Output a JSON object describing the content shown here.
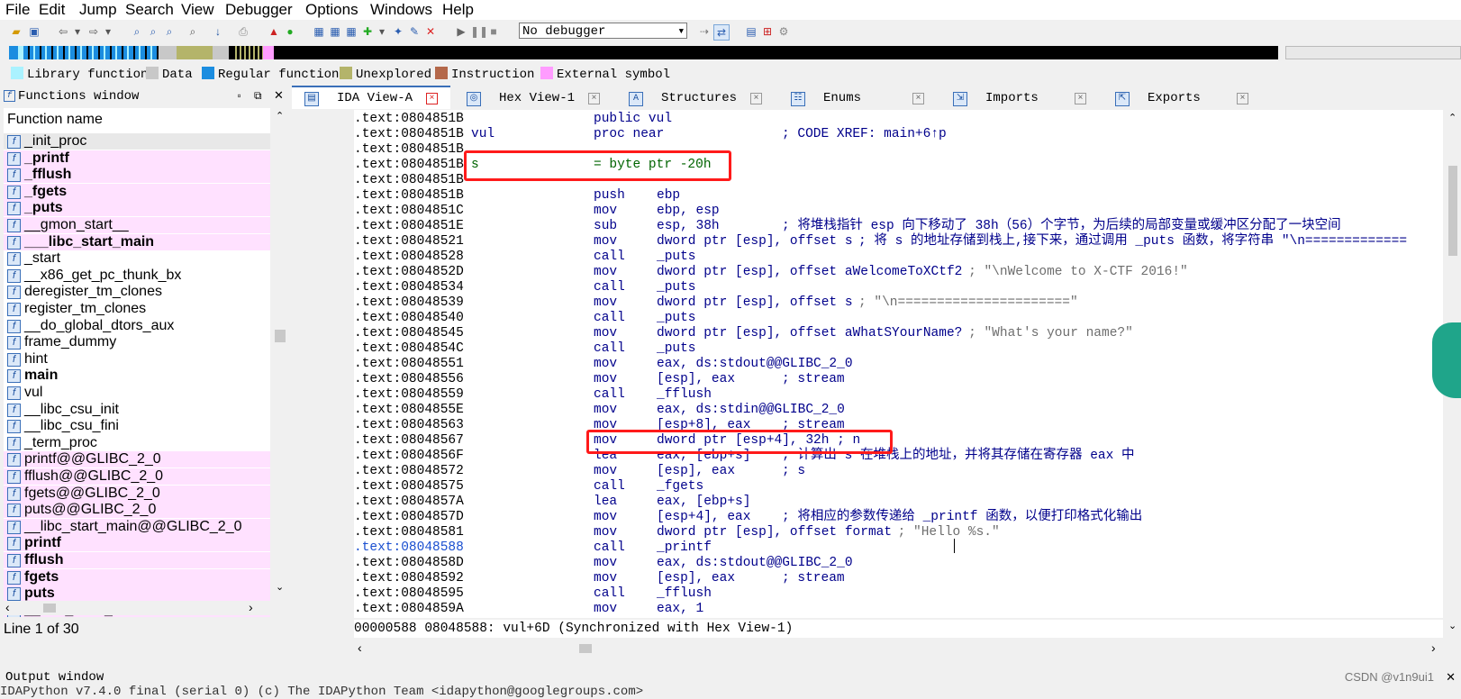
{
  "menu": [
    "File",
    "Edit",
    "Jump",
    "Search",
    "View",
    "Debugger",
    "Options",
    "Windows",
    "Help"
  ],
  "toolbar": {
    "debugger_select": "No debugger"
  },
  "legend": [
    {
      "label": "Library function",
      "color": "#aaf2ff"
    },
    {
      "label": "Data",
      "color": "#c8c8c8"
    },
    {
      "label": "Regular function",
      "color": "#1b8de0"
    },
    {
      "label": "Unexplored",
      "color": "#b4b46a"
    },
    {
      "label": "Instruction",
      "color": "#b4684a"
    },
    {
      "label": "External symbol",
      "color": "#ff9cff"
    }
  ],
  "functions_window": {
    "title": "Functions window",
    "header": "Function name",
    "status": "Line 1 of 30",
    "items": [
      {
        "name": "_init_proc",
        "bold": false,
        "pink": false,
        "sel": true
      },
      {
        "name": "_printf",
        "bold": true,
        "pink": true
      },
      {
        "name": "_fflush",
        "bold": true,
        "pink": true
      },
      {
        "name": "_fgets",
        "bold": true,
        "pink": true
      },
      {
        "name": "_puts",
        "bold": true,
        "pink": true
      },
      {
        "name": "__gmon_start__",
        "bold": false,
        "pink": true
      },
      {
        "name": "___libc_start_main",
        "bold": true,
        "pink": true
      },
      {
        "name": "_start",
        "bold": false,
        "pink": false
      },
      {
        "name": "__x86_get_pc_thunk_bx",
        "bold": false,
        "pink": false
      },
      {
        "name": "deregister_tm_clones",
        "bold": false,
        "pink": false
      },
      {
        "name": "register_tm_clones",
        "bold": false,
        "pink": false
      },
      {
        "name": "__do_global_dtors_aux",
        "bold": false,
        "pink": false
      },
      {
        "name": "frame_dummy",
        "bold": false,
        "pink": false
      },
      {
        "name": "hint",
        "bold": false,
        "pink": false
      },
      {
        "name": "main",
        "bold": true,
        "pink": false
      },
      {
        "name": "vul",
        "bold": false,
        "pink": false
      },
      {
        "name": "__libc_csu_init",
        "bold": false,
        "pink": false
      },
      {
        "name": "__libc_csu_fini",
        "bold": false,
        "pink": false
      },
      {
        "name": "_term_proc",
        "bold": false,
        "pink": false
      },
      {
        "name": "printf@@GLIBC_2_0",
        "bold": false,
        "pink": true
      },
      {
        "name": "fflush@@GLIBC_2_0",
        "bold": false,
        "pink": true
      },
      {
        "name": "fgets@@GLIBC_2_0",
        "bold": false,
        "pink": true
      },
      {
        "name": "puts@@GLIBC_2_0",
        "bold": false,
        "pink": true
      },
      {
        "name": "__libc_start_main@@GLIBC_2_0",
        "bold": false,
        "pink": true
      },
      {
        "name": "printf",
        "bold": true,
        "pink": true
      },
      {
        "name": "fflush",
        "bold": true,
        "pink": true
      },
      {
        "name": "fgets",
        "bold": true,
        "pink": true
      },
      {
        "name": "puts",
        "bold": true,
        "pink": true
      },
      {
        "name": "__libc_start_main",
        "bold": true,
        "pink": true
      }
    ]
  },
  "tabs": [
    {
      "label": "IDA View-A",
      "active": true
    },
    {
      "label": "Hex View-1"
    },
    {
      "label": "Structures"
    },
    {
      "label": "Enums"
    },
    {
      "label": "Imports"
    },
    {
      "label": "Exports"
    }
  ],
  "disasm": [
    {
      "a": ".text:0804851B",
      "l": "",
      "m": "public vul",
      "o": "",
      "c": ""
    },
    {
      "a": ".text:0804851B",
      "l": "vul",
      "m": "proc near",
      "o": "",
      "c": "; CODE XREF: main+6↑p"
    },
    {
      "a": ".text:0804851B",
      "l": "",
      "m": "",
      "o": "",
      "c": ""
    },
    {
      "a": ".text:0804851B",
      "l": "s",
      "m": "= byte ptr -20h",
      "o": "",
      "c": "",
      "green": true
    },
    {
      "a": ".text:0804851B",
      "l": "",
      "m": "",
      "o": "",
      "c": ""
    },
    {
      "a": ".text:0804851B",
      "l": "",
      "m": "push",
      "o": "ebp",
      "c": "",
      "dot": true
    },
    {
      "a": ".text:0804851C",
      "l": "",
      "m": "mov",
      "o": "ebp, esp",
      "c": "",
      "dot": true
    },
    {
      "a": ".text:0804851E",
      "l": "",
      "m": "sub",
      "o": "esp, 38h",
      "c": "; 将堆栈指针 esp 向下移动了 38h（56）个字节，为后续的局部变量或缓冲区分配了一块空间",
      "dot": true
    },
    {
      "a": ".text:08048521",
      "l": "",
      "m": "mov",
      "o": "dword ptr [esp], offset s",
      "c": "; 将 s 的地址存储到栈上,接下来，通过调用 _puts 函数，将字符串 \"\\n=============",
      "dot": true
    },
    {
      "a": ".text:08048528",
      "l": "",
      "m": "call",
      "o": "_puts",
      "c": "",
      "dot": true
    },
    {
      "a": ".text:0804852D",
      "l": "",
      "m": "mov",
      "o": "dword ptr [esp], offset aWelcomeToXCtf2",
      "c": "; \"\\nWelcome to X-CTF 2016!\"",
      "dot": true,
      "strc": true
    },
    {
      "a": ".text:08048534",
      "l": "",
      "m": "call",
      "o": "_puts",
      "c": "",
      "dot": true
    },
    {
      "a": ".text:08048539",
      "l": "",
      "m": "mov",
      "o": "dword ptr [esp], offset s",
      "c": "; \"\\n======================\"",
      "dot": true,
      "strc": true
    },
    {
      "a": ".text:08048540",
      "l": "",
      "m": "call",
      "o": "_puts",
      "c": "",
      "dot": true
    },
    {
      "a": ".text:08048545",
      "l": "",
      "m": "mov",
      "o": "dword ptr [esp], offset aWhatSYourName?",
      "c": "; \"What's your name?\"",
      "dot": true,
      "strc": true
    },
    {
      "a": ".text:0804854C",
      "l": "",
      "m": "call",
      "o": "_puts",
      "c": "",
      "dot": true
    },
    {
      "a": ".text:08048551",
      "l": "",
      "m": "mov",
      "o": "eax, ds:stdout@@GLIBC_2_0",
      "c": "",
      "dot": true
    },
    {
      "a": ".text:08048556",
      "l": "",
      "m": "mov",
      "o": "[esp], eax",
      "c": "; stream",
      "dot": true
    },
    {
      "a": ".text:08048559",
      "l": "",
      "m": "call",
      "o": "_fflush",
      "c": "",
      "dot": true
    },
    {
      "a": ".text:0804855E",
      "l": "",
      "m": "mov",
      "o": "eax, ds:stdin@@GLIBC_2_0",
      "c": "",
      "dot": true
    },
    {
      "a": ".text:08048563",
      "l": "",
      "m": "mov",
      "o": "[esp+8], eax",
      "c": "; stream",
      "dot": true
    },
    {
      "a": ".text:08048567",
      "l": "",
      "m": "mov",
      "o": "dword ptr [esp+4], 32h ; n",
      "c": "",
      "dot": true
    },
    {
      "a": ".text:0804856F",
      "l": "",
      "m": "lea",
      "o": "eax, [ebp+s]",
      "c": "; 计算出 s 在堆栈上的地址，并将其存储在寄存器 eax 中",
      "dot": true
    },
    {
      "a": ".text:08048572",
      "l": "",
      "m": "mov",
      "o": "[esp], eax",
      "c": "; s",
      "dot": true
    },
    {
      "a": ".text:08048575",
      "l": "",
      "m": "call",
      "o": "_fgets",
      "c": "",
      "dot": true
    },
    {
      "a": ".text:0804857A",
      "l": "",
      "m": "lea",
      "o": "eax, [ebp+s]",
      "c": "",
      "dot": true
    },
    {
      "a": ".text:0804857D",
      "l": "",
      "m": "mov",
      "o": "[esp+4], eax",
      "c": "; 将相应的参数传递给 _printf 函数，以便打印格式化输出",
      "dot": true
    },
    {
      "a": ".text:08048581",
      "l": "",
      "m": "mov",
      "o": "dword ptr [esp], offset format",
      "c": "; \"Hello %s.\"",
      "dot": true,
      "strc": true
    },
    {
      "a": ".text:08048588",
      "l": "",
      "m": "call",
      "o": "_printf",
      "c": "",
      "dot": true,
      "cur": true
    },
    {
      "a": ".text:0804858D",
      "l": "",
      "m": "mov",
      "o": "eax, ds:stdout@@GLIBC_2_0",
      "c": "",
      "dot": true
    },
    {
      "a": ".text:08048592",
      "l": "",
      "m": "mov",
      "o": "[esp], eax",
      "c": "; stream",
      "dot": true
    },
    {
      "a": ".text:08048595",
      "l": "",
      "m": "call",
      "o": "_fflush",
      "c": "",
      "dot": true
    },
    {
      "a": ".text:0804859A",
      "l": "",
      "m": "mov",
      "o": "eax, 1",
      "c": "",
      "dot": true
    }
  ],
  "status_line": "00000588 08048588: vul+6D (Synchronized with Hex View-1)",
  "output_window": {
    "title": "Output window",
    "line": "IDAPython v7.4.0 final (serial 0) (c) The IDAPython Team <idapython@googlegroups.com>"
  },
  "watermark": "CSDN @v1n9ui1"
}
